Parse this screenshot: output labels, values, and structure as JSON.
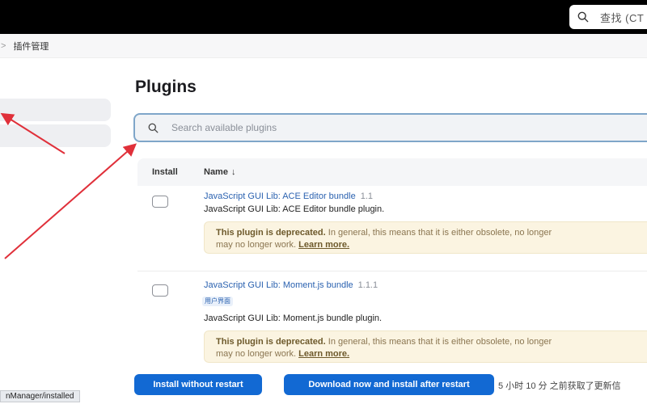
{
  "header": {
    "search_placeholder": "查找 (CT",
    "search_icon": "search-icon"
  },
  "breadcrumb": {
    "separator": ">",
    "current": "插件管理"
  },
  "page": {
    "title": "Plugins"
  },
  "plugin_search": {
    "placeholder": "Search available plugins",
    "icon": "search-icon"
  },
  "table": {
    "columns": {
      "install": "Install",
      "name": "Name",
      "sort_indicator": "↓"
    },
    "rows": [
      {
        "name": "JavaScript GUI Lib: ACE Editor bundle",
        "version": "1.1",
        "description": "JavaScript GUI Lib: ACE Editor bundle plugin.",
        "checked": false,
        "warning": {
          "title": "This plugin is deprecated.",
          "text1": "In general, this means that it is either obsolete, no longer",
          "text2": "may no longer work.",
          "link": "Learn more."
        }
      },
      {
        "name": "JavaScript GUI Lib: Moment.js bundle",
        "version": "1.1.1",
        "tag": "用户界面",
        "description": "JavaScript GUI Lib: Moment.js bundle plugin.",
        "checked": false,
        "warning": {
          "title": "This plugin is deprecated.",
          "text1": "In general, this means that it is either obsolete, no longer",
          "text2": "may no longer work.",
          "link": "Learn more."
        }
      }
    ]
  },
  "actions": {
    "install_without_restart": "Install without restart",
    "download_and_install": "Download now and install after restart",
    "update_info": "5 小时 10 分 之前获取了更新信"
  },
  "status_bar": {
    "url": "nManager/installed"
  },
  "colors": {
    "primary_button": "#1269d3",
    "link": "#2b62b0",
    "warning_bg": "#fbf4e1",
    "annotation_arrow": "#e0303a"
  }
}
